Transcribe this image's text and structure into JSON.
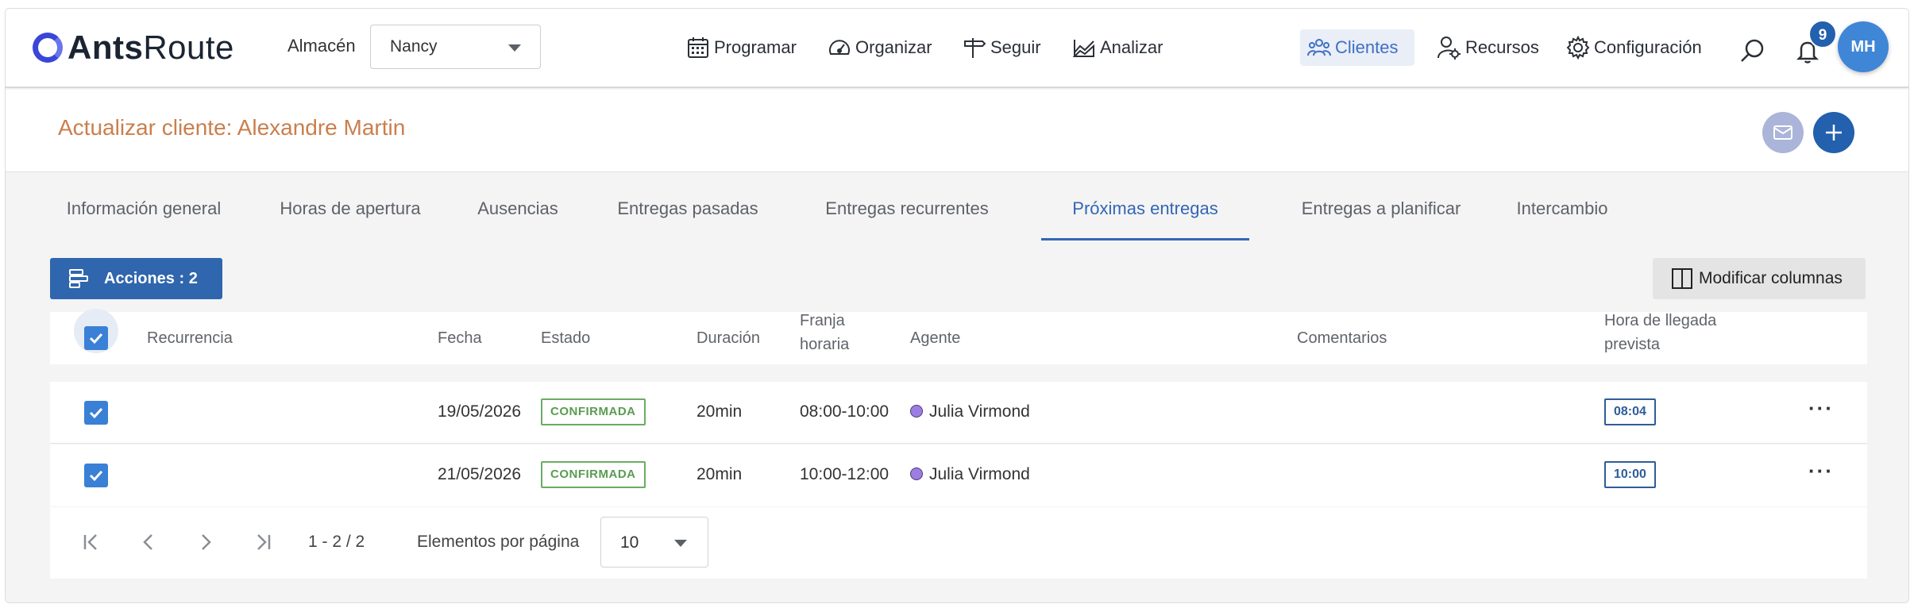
{
  "app": {
    "logo_bold": "Ants",
    "logo_light": "Route"
  },
  "header": {
    "warehouse_label": "Almacén",
    "warehouse_value": "Nancy",
    "nav": {
      "programar": "Programar",
      "organizar": "Organizar",
      "seguir": "Seguir",
      "analizar": "Analizar",
      "clientes": "Clientes",
      "recursos": "Recursos",
      "configuracion": "Configuración"
    },
    "notification_count": "9",
    "avatar_initials": "MH"
  },
  "page": {
    "title": "Actualizar cliente: Alexandre Martin"
  },
  "tabs": [
    {
      "label": "Información general"
    },
    {
      "label": "Horas de apertura"
    },
    {
      "label": "Ausencias"
    },
    {
      "label": "Entregas pasadas"
    },
    {
      "label": "Entregas recurrentes"
    },
    {
      "label": "Próximas entregas",
      "active": true
    },
    {
      "label": "Entregas a planificar"
    },
    {
      "label": "Intercambio"
    }
  ],
  "toolbar": {
    "actions_label": "Acciones : 2",
    "columns_label": "Modificar columnas"
  },
  "table": {
    "headers": {
      "recurrence": "Recurrencia",
      "date": "Fecha",
      "status": "Estado",
      "duration": "Duración",
      "slot_line1": "Franja",
      "slot_line2": "horaria",
      "agent": "Agente",
      "comments": "Comentarios",
      "eta_line1": "Hora de llegada",
      "eta_line2": "prevista"
    },
    "rows": [
      {
        "checked": true,
        "recurrence": "",
        "date": "19/05/2026",
        "status": "CONFIRMADA",
        "duration": "20min",
        "slot": "08:00-10:00",
        "agent": "Julia Virmond",
        "comments": "",
        "eta": "08:04"
      },
      {
        "checked": true,
        "recurrence": "",
        "date": "21/05/2026",
        "status": "CONFIRMADA",
        "duration": "20min",
        "slot": "10:00-12:00",
        "agent": "Julia Virmond",
        "comments": "",
        "eta": "10:00"
      }
    ]
  },
  "pagination": {
    "range": "1 - 2 / 2",
    "per_page_label": "Elementos por página",
    "per_page_value": "10"
  },
  "colors": {
    "primary": "#2f66ad",
    "accent_title": "#c97f4d",
    "status_green": "#5a9c51",
    "agent_dot": "#9b7de3",
    "active_tab": "#3266b4"
  }
}
